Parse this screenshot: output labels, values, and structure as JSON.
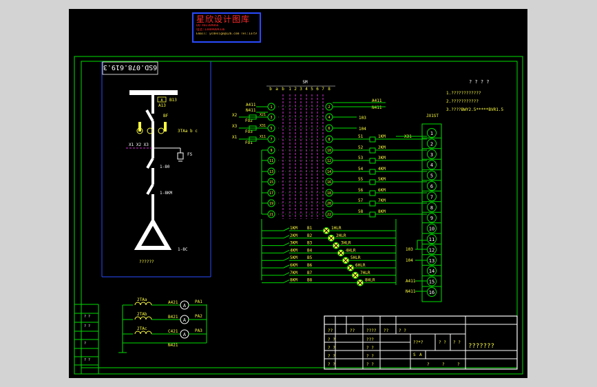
{
  "banner": {
    "title": "星欣设计图库",
    "line1": "QQ:402309066",
    "line2": "电话:13809009336",
    "line3": "Email: ycdesign@126.com  Tel:13759339955"
  },
  "drawing_no": "6SD.078.619.3",
  "panel_labels": {
    "tag_ct": "A",
    "ct_a": "A13",
    "ct_b": "B13",
    "bf": "BF",
    "ct_note": "3TAa b c",
    "x_labels": "X1 X2 X3",
    "fs": "FS",
    "sw1": "1-80",
    "sw2": "1-8KM",
    "sw3": "1-8C",
    "caption": "??????"
  },
  "sm": {
    "title": "SM",
    "cols": [
      "b",
      "a",
      "b",
      "1",
      "2",
      "3",
      "4",
      "5",
      "6",
      "7",
      "8"
    ],
    "left_pins": [
      "1",
      "3",
      "5",
      "7",
      "9",
      "11",
      "13",
      "15",
      "17",
      "19",
      "21",
      "23"
    ],
    "right_pins": [
      "2",
      "4",
      "6",
      "8",
      "10",
      "12",
      "14",
      "16",
      "18",
      "20",
      "22",
      "24"
    ],
    "left_labels": [
      "A411",
      "N411",
      "X2",
      "X3",
      "X1",
      "FU2",
      "FU3",
      "FU1"
    ],
    "k_labels": [
      "X21",
      "X31",
      "X11"
    ],
    "right_labels": [
      "A411",
      "N411",
      "103",
      "104"
    ]
  },
  "relay_rows": [
    {
      "wire": "51",
      "coil": "1KM"
    },
    {
      "wire": "52",
      "coil": "2KM"
    },
    {
      "wire": "53",
      "coil": "3KM"
    },
    {
      "wire": "54",
      "coil": "4KM"
    },
    {
      "wire": "55",
      "coil": "5KM"
    },
    {
      "wire": "56",
      "coil": "6KM"
    },
    {
      "wire": "57",
      "coil": "7KM"
    },
    {
      "wire": "58",
      "coil": "8KM"
    }
  ],
  "x31": "X31",
  "lamps": [
    {
      "km": "1KM",
      "b": "B1",
      "lamp": "1HLR"
    },
    {
      "km": "2KM",
      "b": "B2",
      "lamp": "2HLR"
    },
    {
      "km": "3KM",
      "b": "B3",
      "lamp": "3HLR"
    },
    {
      "km": "4KM",
      "b": "B4",
      "lamp": "4HLR"
    },
    {
      "km": "5KM",
      "b": "B5",
      "lamp": "5HLR"
    },
    {
      "km": "6KM",
      "b": "B6",
      "lamp": "6HLR"
    },
    {
      "km": "7KM",
      "b": "B7",
      "lamp": "7HLR"
    },
    {
      "km": "8KM",
      "b": "B8",
      "lamp": "8HLR"
    }
  ],
  "terminal": {
    "title": "JX1ST",
    "numbers": [
      "1",
      "2",
      "3",
      "4",
      "5",
      "6",
      "7",
      "8",
      "9",
      "10",
      "11",
      "12",
      "13",
      "14",
      "15",
      "16"
    ],
    "side_labels": [
      "103",
      "104",
      "A411",
      "N411"
    ]
  },
  "notes": {
    "title": "? ? ? ?",
    "items": [
      "1.????????????",
      "2.???????????",
      "3.????BWY2.5*****BVR1.5"
    ]
  },
  "ammeters": [
    {
      "ct": "2TAa",
      "wire": "A421",
      "meter": "PA1"
    },
    {
      "ct": "2TAb",
      "wire": "B421",
      "meter": "PA2"
    },
    {
      "ct": "2TAc",
      "wire": "C421",
      "meter": "PA3"
    }
  ],
  "ammeter_symbol": "A",
  "ammeter_return": "N421",
  "title_block": {
    "name": "???????",
    "r1": [
      "??",
      "??",
      "????",
      "??",
      "? ?"
    ],
    "c1": [
      "? ?",
      "? ?",
      "? ?",
      "? ?"
    ],
    "c2": [
      "???",
      "? ?",
      "? ?",
      "? ?"
    ],
    "mid": [
      "??*?",
      "? ?",
      "? ?"
    ],
    "scale": [
      "S",
      "A"
    ],
    "bottom": [
      "?",
      "?",
      "?"
    ]
  },
  "rev_block": [
    "? ?",
    "? ?",
    "?",
    "? ?"
  ],
  "colors": {
    "line": "#00e000",
    "text": "#ffff40",
    "white": "#ffffff",
    "dash": "#d030d0",
    "banner_border": "#2a4bff",
    "banner_text": "#ff2a2a"
  }
}
